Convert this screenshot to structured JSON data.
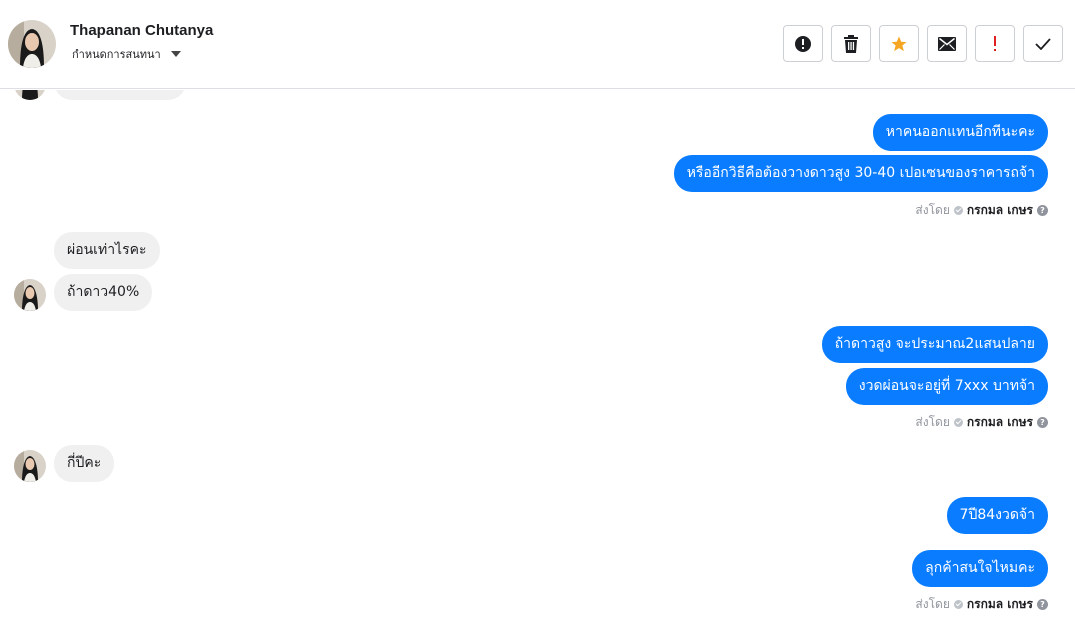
{
  "header": {
    "contact_name": "Thapanan Chutanya",
    "assign_label": "กำหนดการสนทนา",
    "actions": [
      {
        "name": "mark-spam",
        "icon": "alert-circle-icon"
      },
      {
        "name": "delete",
        "icon": "trash-icon"
      },
      {
        "name": "star",
        "icon": "star-icon",
        "color": "#f5a623"
      },
      {
        "name": "mark-unread",
        "icon": "envelope-icon"
      },
      {
        "name": "follow-up",
        "icon": "exclamation-icon",
        "color": "#e02020"
      },
      {
        "name": "mark-done",
        "icon": "check-icon"
      }
    ]
  },
  "messages": {
    "out_1": "หาคนออกแทนอีกทีนะคะ",
    "out_2": "หรืออีกวิธีคือต้องวางดาวสูง 30-40 เปอเซนของราคารถจ้า",
    "in_1": "ผ่อนเท่าไรคะ",
    "in_2": "ถ้าดาว40%",
    "out_3": "ถ้าดาวสูง จะประมาณ2แสนปลาย",
    "out_4": "งวดผ่อนจะอยู่ที่ 7xxx บาทจ้า",
    "in_3": "กี่ปีคะ",
    "out_5": "7ปี84งวดจ้า",
    "out_6": "ลุกค้าสนใจไหมคะ"
  },
  "sent_by": {
    "prefix": "ส่งโดย",
    "sender": "กรกมล เกษร",
    "help": "?"
  },
  "colors": {
    "outgoing_bubble": "#0a7cff",
    "incoming_bubble": "#f1f0f0"
  }
}
